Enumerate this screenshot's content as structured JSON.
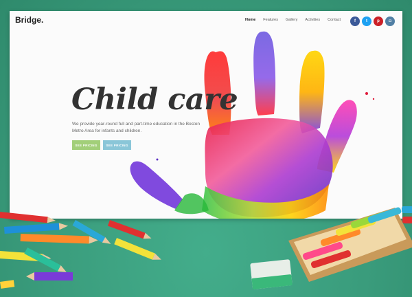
{
  "site": {
    "logo": "Bridge.",
    "nav": [
      "Home",
      "Features",
      "Gallery",
      "Activities",
      "Contact"
    ],
    "social": [
      {
        "icon": "facebook-icon",
        "glyph": "f",
        "color": "#3b5998"
      },
      {
        "icon": "twitter-icon",
        "glyph": "t",
        "color": "#1da1f2"
      },
      {
        "icon": "pinterest-icon",
        "glyph": "p",
        "color": "#cb2027"
      },
      {
        "icon": "instagram-icon",
        "glyph": "◘",
        "color": "#517fa4"
      }
    ]
  },
  "hero": {
    "title": "Child care",
    "description": "We provide year-round full and part-time education in the Boston Metro Area for infants and children.",
    "button_primary": "SEE PRICING",
    "button_secondary": "SEE PRICING"
  },
  "colors": {
    "background": "#3a9c7c",
    "button_primary": "#a2cf79",
    "button_secondary": "#8ac6d8"
  }
}
